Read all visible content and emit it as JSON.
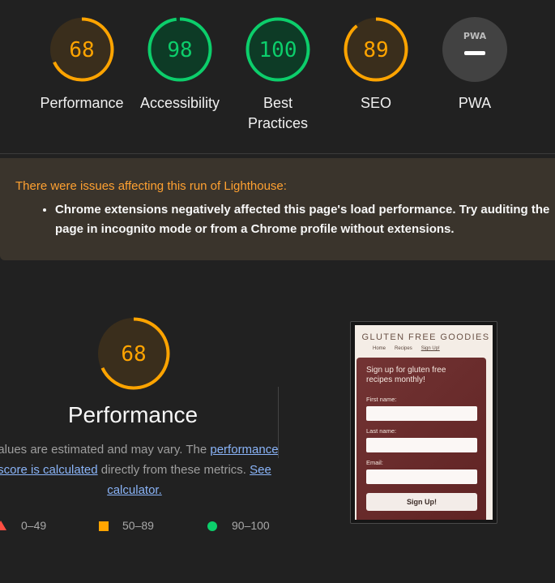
{
  "colors": {
    "average": "#ffa400",
    "pass": "#0cce6b",
    "fail": "#ff4e42",
    "neutral": "#9e9e9e",
    "warning_text": "#ffa131",
    "link": "#8ab4f8"
  },
  "categories": [
    {
      "label": "Performance",
      "score": "68",
      "value": 68,
      "rating": "average"
    },
    {
      "label": "Accessibility",
      "score": "98",
      "value": 98,
      "rating": "pass"
    },
    {
      "label": "Best\nPractices",
      "score": "100",
      "value": 100,
      "rating": "pass"
    },
    {
      "label": "SEO",
      "score": "89",
      "value": 89,
      "rating": "average"
    },
    {
      "label": "PWA",
      "badge": "PWA",
      "rating": "neutral"
    }
  ],
  "warning": {
    "title": "There were issues affecting this run of Lighthouse:",
    "items": [
      "Chrome extensions negatively affected this page's load performance. Try auditing the page in incognito mode or from a Chrome profile without extensions."
    ]
  },
  "performance": {
    "score": "68",
    "value": 68,
    "title": "Performance",
    "desc_1": "Values are estimated and may vary. The ",
    "desc_link_1": "performance score is calculated",
    "desc_2": " directly from these metrics. ",
    "desc_link_2": "See calculator."
  },
  "legend": [
    {
      "shape": "triangle",
      "label": "0–49"
    },
    {
      "shape": "square",
      "label": "50–89"
    },
    {
      "shape": "circle",
      "label": "90–100"
    }
  ],
  "screenshot": {
    "site_title": "GLUTEN FREE GOODIES",
    "nav": [
      "Home",
      "Recipes",
      "Sign Up!"
    ],
    "heading": "Sign up for gluten free recipes monthly!",
    "fields": [
      "First name:",
      "Last name:",
      "Email:"
    ],
    "button": "Sign Up!"
  }
}
